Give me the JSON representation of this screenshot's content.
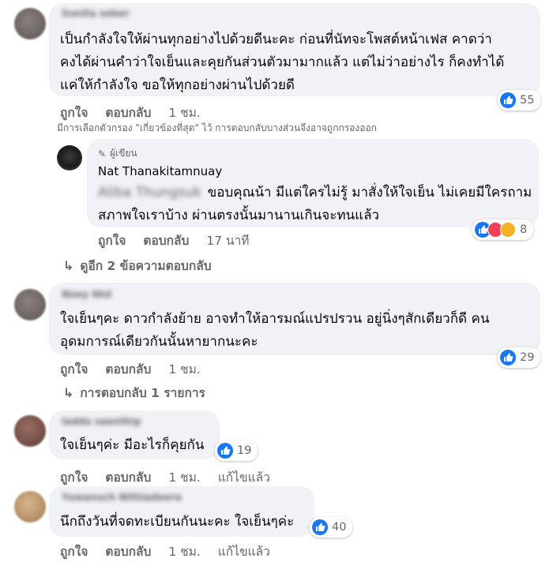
{
  "comments": [
    {
      "author": "Sunita seber",
      "lines": [
        "เป็นกำลังใจให้ผ่านทุกอย่างไปด้วยดีนะคะ ก่อนที่นัทจะโพสต์หน้าเฟส คาดว่า",
        "คงได้ผ่านคำว่าใจเย็นและคุยกันส่วนตัวมามากแล้ว แต่ไม่ว่าอย่างไร ก็คงทำได้",
        "แค่ให้กำลังใจ ขอให้ทุกอย่างผ่านไปด้วยดี"
      ],
      "like_label": "ถูกใจ",
      "reply_label": "ตอบกลับ",
      "time": "1 ชม.",
      "reactions": "55"
    },
    {
      "author": "Noey Ntd",
      "lines": [
        "ใจเย็นๆคะ ดาวกำลังย้าย อาจทำให้อารมณ์แปรปรวน อยู่นิ่งๆสักเดียวก็ดี คน",
        "อุดมการณ์เดียวกันนั้นหายากนะคะ"
      ],
      "like_label": "ถูกใจ",
      "reply_label": "ตอบกลับ",
      "time": "1 ชม.",
      "reactions": "29"
    },
    {
      "author": "ladda saenthip",
      "lines": [
        "ใจเย็นๆค่ะ มีอะไรก็คุยกัน"
      ],
      "like_label": "ถูกใจ",
      "reply_label": "ตอบกลับ",
      "time": "1 ชม.",
      "edited": "แก้ไขแล้ว",
      "reactions": "19"
    },
    {
      "author": "Yuwanuch Nithiadeera",
      "lines": [
        "นึกถึงวันที่จดทะเบียนกันนะคะ ใจเย็นๆค่ะ"
      ],
      "like_label": "ถูกใจ",
      "reply_label": "ตอบกลับ",
      "time": "1 ชม.",
      "edited": "แก้ไขแล้ว",
      "reactions": "40"
    }
  ],
  "filter_note": "มีการเลือกตัวกรอง \"เกี่ยวข้องที่สุด\" ไว้ การตอบกลับบางส่วนจึงอาจถูกกรองออก",
  "reply": {
    "badge": "ผู้เขียน",
    "author": "Nat Thanakitamnuay",
    "mention": "Aliba Thungsuk",
    "line1": "ขอบคุณน้า มีแต่ใครไม่รู้ มาสั่งให้ใจเย็น ไม่เคยมีใครถาม",
    "line2": "สภาพใจเราบ้าง ผ่านตรงนั้นมานานเกินจะทนแล้ว",
    "like_label": "ถูกใจ",
    "reply_label": "ตอบกลับ",
    "time": "17 นาที",
    "reactions": "8"
  },
  "more_replies": "ดูอีก 2 ข้อความตอบกลับ",
  "reply_count": "การตอบกลับ 1 รายการ",
  "colors": {
    "like_blue": "#1877f2",
    "bubble": "#f0f2f5",
    "meta_gray": "#65676b"
  }
}
